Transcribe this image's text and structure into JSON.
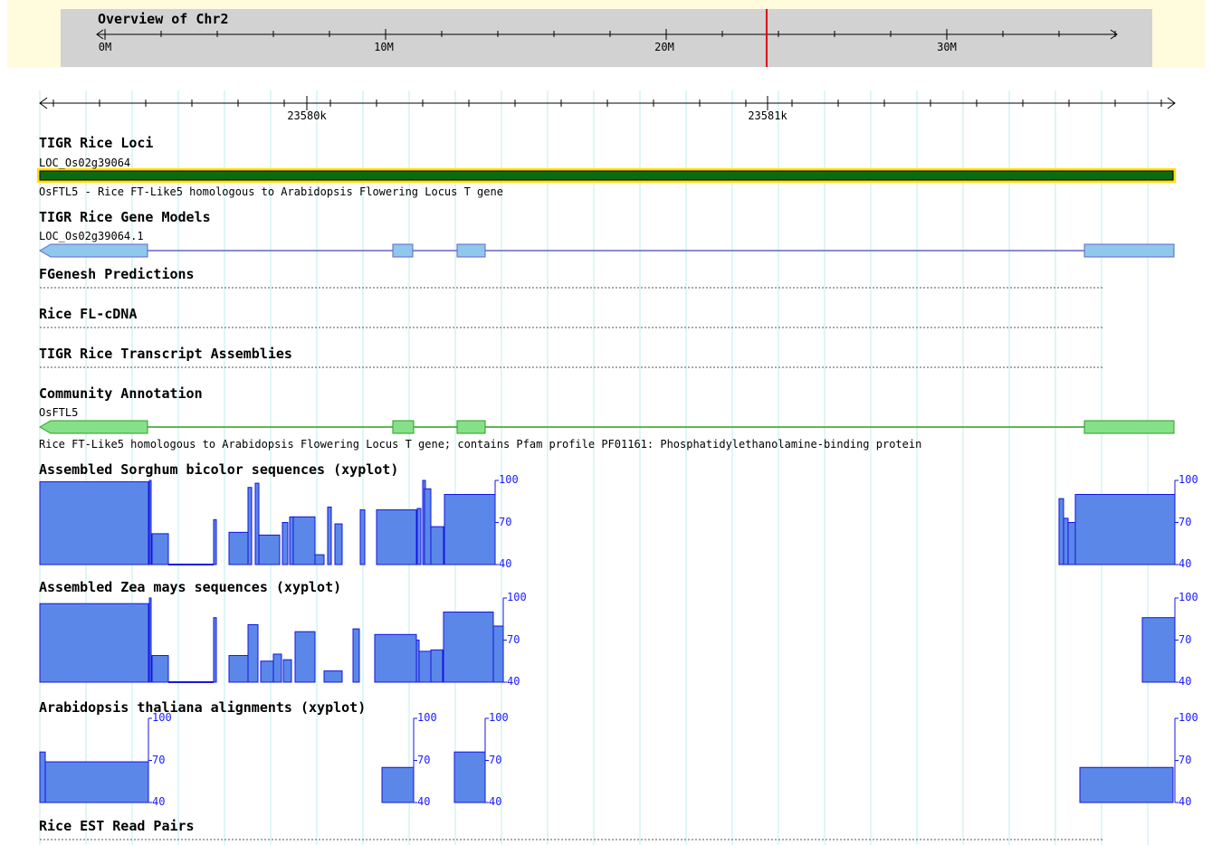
{
  "overview": {
    "title": "Overview of Chr2",
    "ticks": [
      "0M",
      "10M",
      "20M",
      "30M"
    ],
    "marker_mb": 23.58
  },
  "ruler": {
    "labels": [
      "23580k",
      "23581k"
    ]
  },
  "tracks": {
    "loci": {
      "label": "TIGR Rice Loci",
      "feature_name": "LOC_Os02g39064",
      "description": "OsFTL5 - Rice FT-Like5 homologous to Arabidopsis Flowering Locus T gene"
    },
    "gene_models": {
      "label": "TIGR Rice Gene Models",
      "feature_name": "LOC_Os02g39064.1"
    },
    "fgenesh": {
      "label": "FGenesh Predictions"
    },
    "flcdna": {
      "label": "Rice FL-cDNA"
    },
    "transcripts": {
      "label": "TIGR Rice Transcript Assemblies"
    },
    "community": {
      "label": "Community Annotation",
      "feature_name": "OsFTL5",
      "description": "Rice FT-Like5 homologous to Arabidopsis Flowering Locus T gene; contains Pfam profile PF01161: Phosphatidylethanolamine-binding protein"
    },
    "sorghum": {
      "label": "Assembled Sorghum bicolor sequences (xyplot)"
    },
    "zea": {
      "label": "Assembled Zea mays sequences (xyplot)"
    },
    "arabidopsis": {
      "label": "Arabidopsis thaliana alignments (xyplot)"
    },
    "est": {
      "label": "Rice EST Read Pairs"
    }
  },
  "scale": {
    "top": "100",
    "mid": "70",
    "bottom": "40"
  },
  "colors": {
    "overview_bg": "#d2d2d2",
    "overview_band": "#fffbdc",
    "marker": "#e3001b",
    "grid": "#bfeeee",
    "locus_fill": "#0c6a14",
    "locus_outline": "#ffe000",
    "gene_fill": "#8ec8ec",
    "gene_stroke": "#6363c8",
    "community_fill": "#86e08a",
    "community_stroke": "#2b9e22",
    "xy_fill": "#5b88e8",
    "xy_stroke": "#1515e0"
  }
}
